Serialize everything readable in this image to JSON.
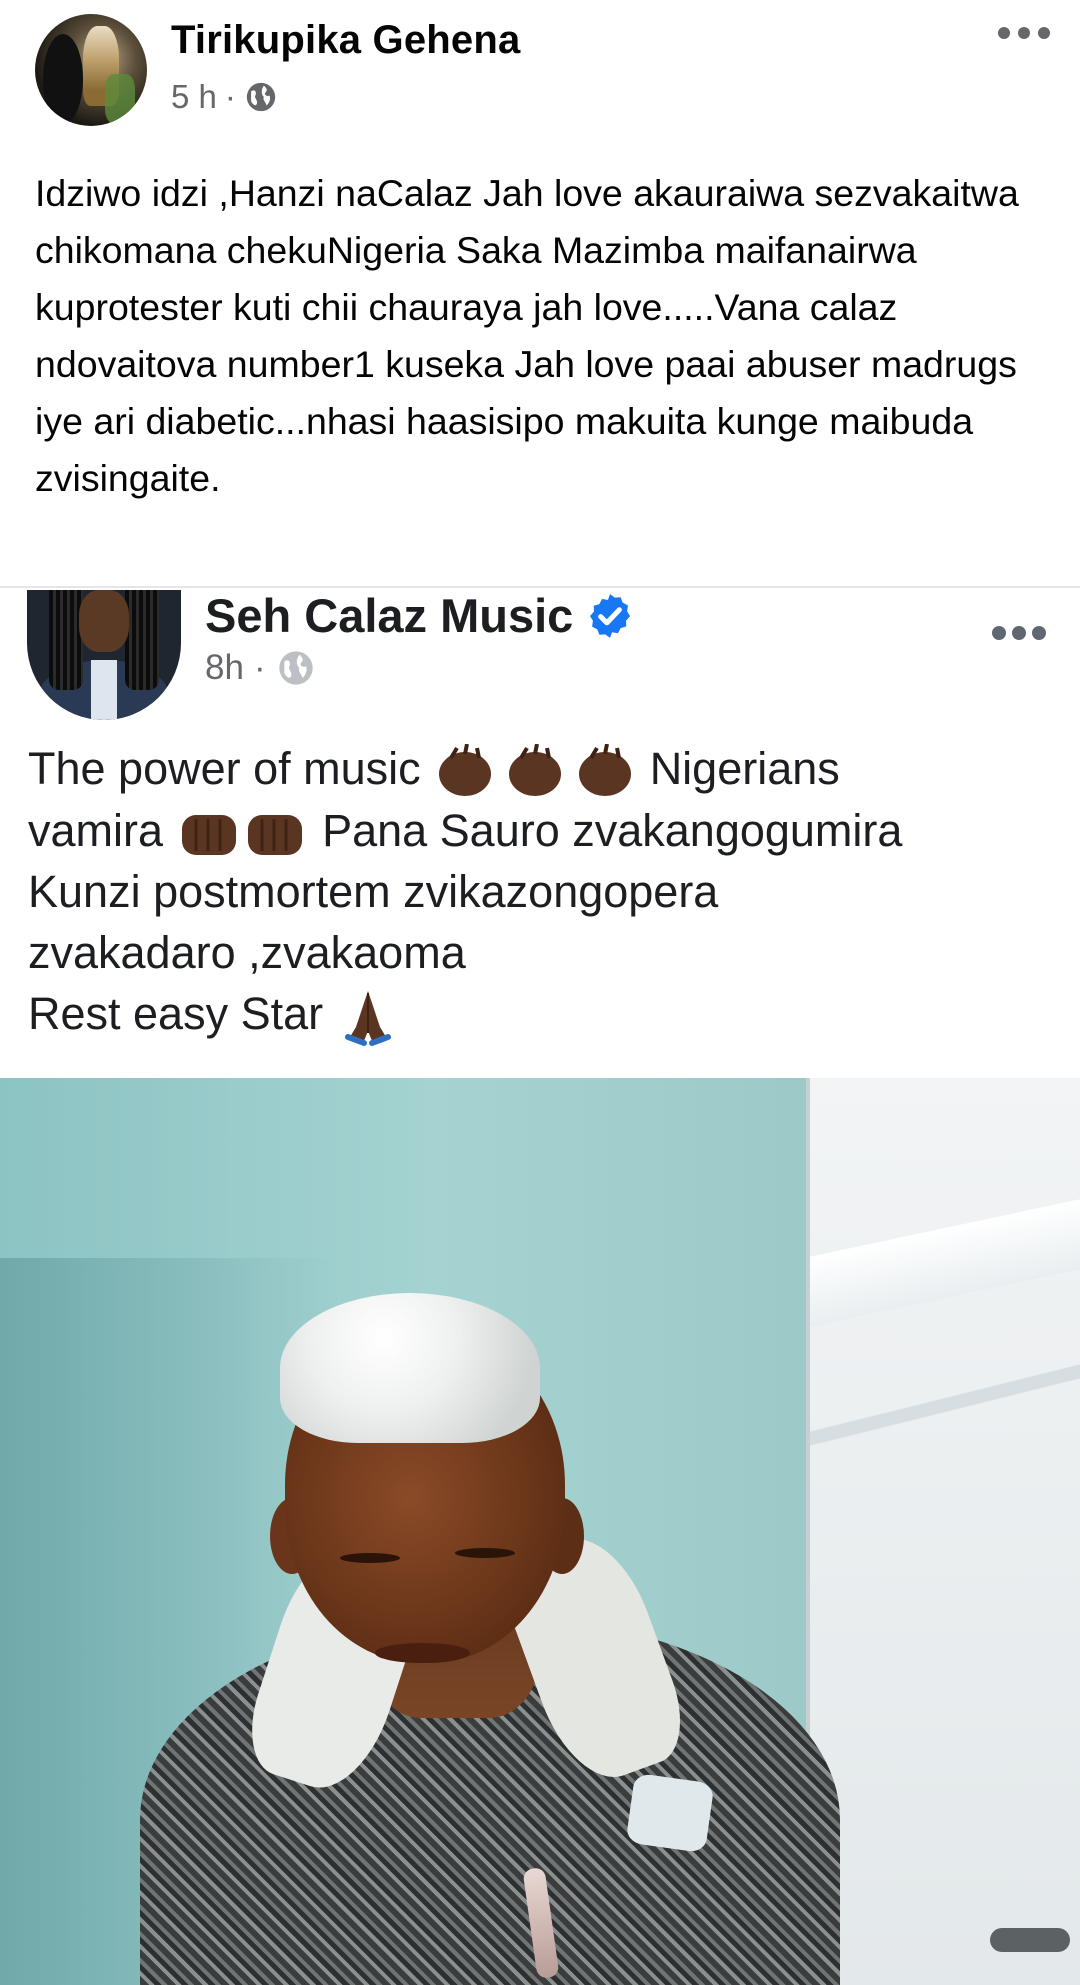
{
  "post": {
    "author": "Tirikupika Gehena",
    "time": "5 h",
    "separator": "·",
    "privacy_icon": "globe-icon",
    "more_icon": "more-options-icon",
    "text": "Idziwo idzi ,Hanzi naCalaz Jah love akauraiwa sezvakaitwa chikomana chekuNigeria Saka Mazimba maifanairwa kuprotester kuti chii chauraya jah love.....Vana calaz ndovaitova number1 kuseka Jah love paai abuser madrugs iye ari diabetic...nhasi haasisipo makuita kunge maibuda zvisingaite."
  },
  "shared_post": {
    "page_name": "Seh Calaz Music",
    "verified_icon": "verified-badge-icon",
    "time": "8h",
    "separator": "·",
    "privacy_icon": "globe-icon",
    "line1_a": "The power of music",
    "line1_b": "Nigerians",
    "line2_a": "vamira",
    "line2_b": "Pana Sauro zvakangogumira",
    "line3": "Kunzi postmortem zvikazongopera",
    "line4": "zvakadaro ,zvakaoma",
    "line5": "Rest easy Star",
    "emoji_clap": "clapping-hands-emoji",
    "emoji_fist": "oncoming-fist-emoji",
    "emoji_pray": "folded-hands-emoji"
  },
  "colors": {
    "text_primary": "#050505",
    "text_secondary": "#65676b",
    "verified_blue": "#1877f2",
    "divider": "#e4e6eb"
  }
}
